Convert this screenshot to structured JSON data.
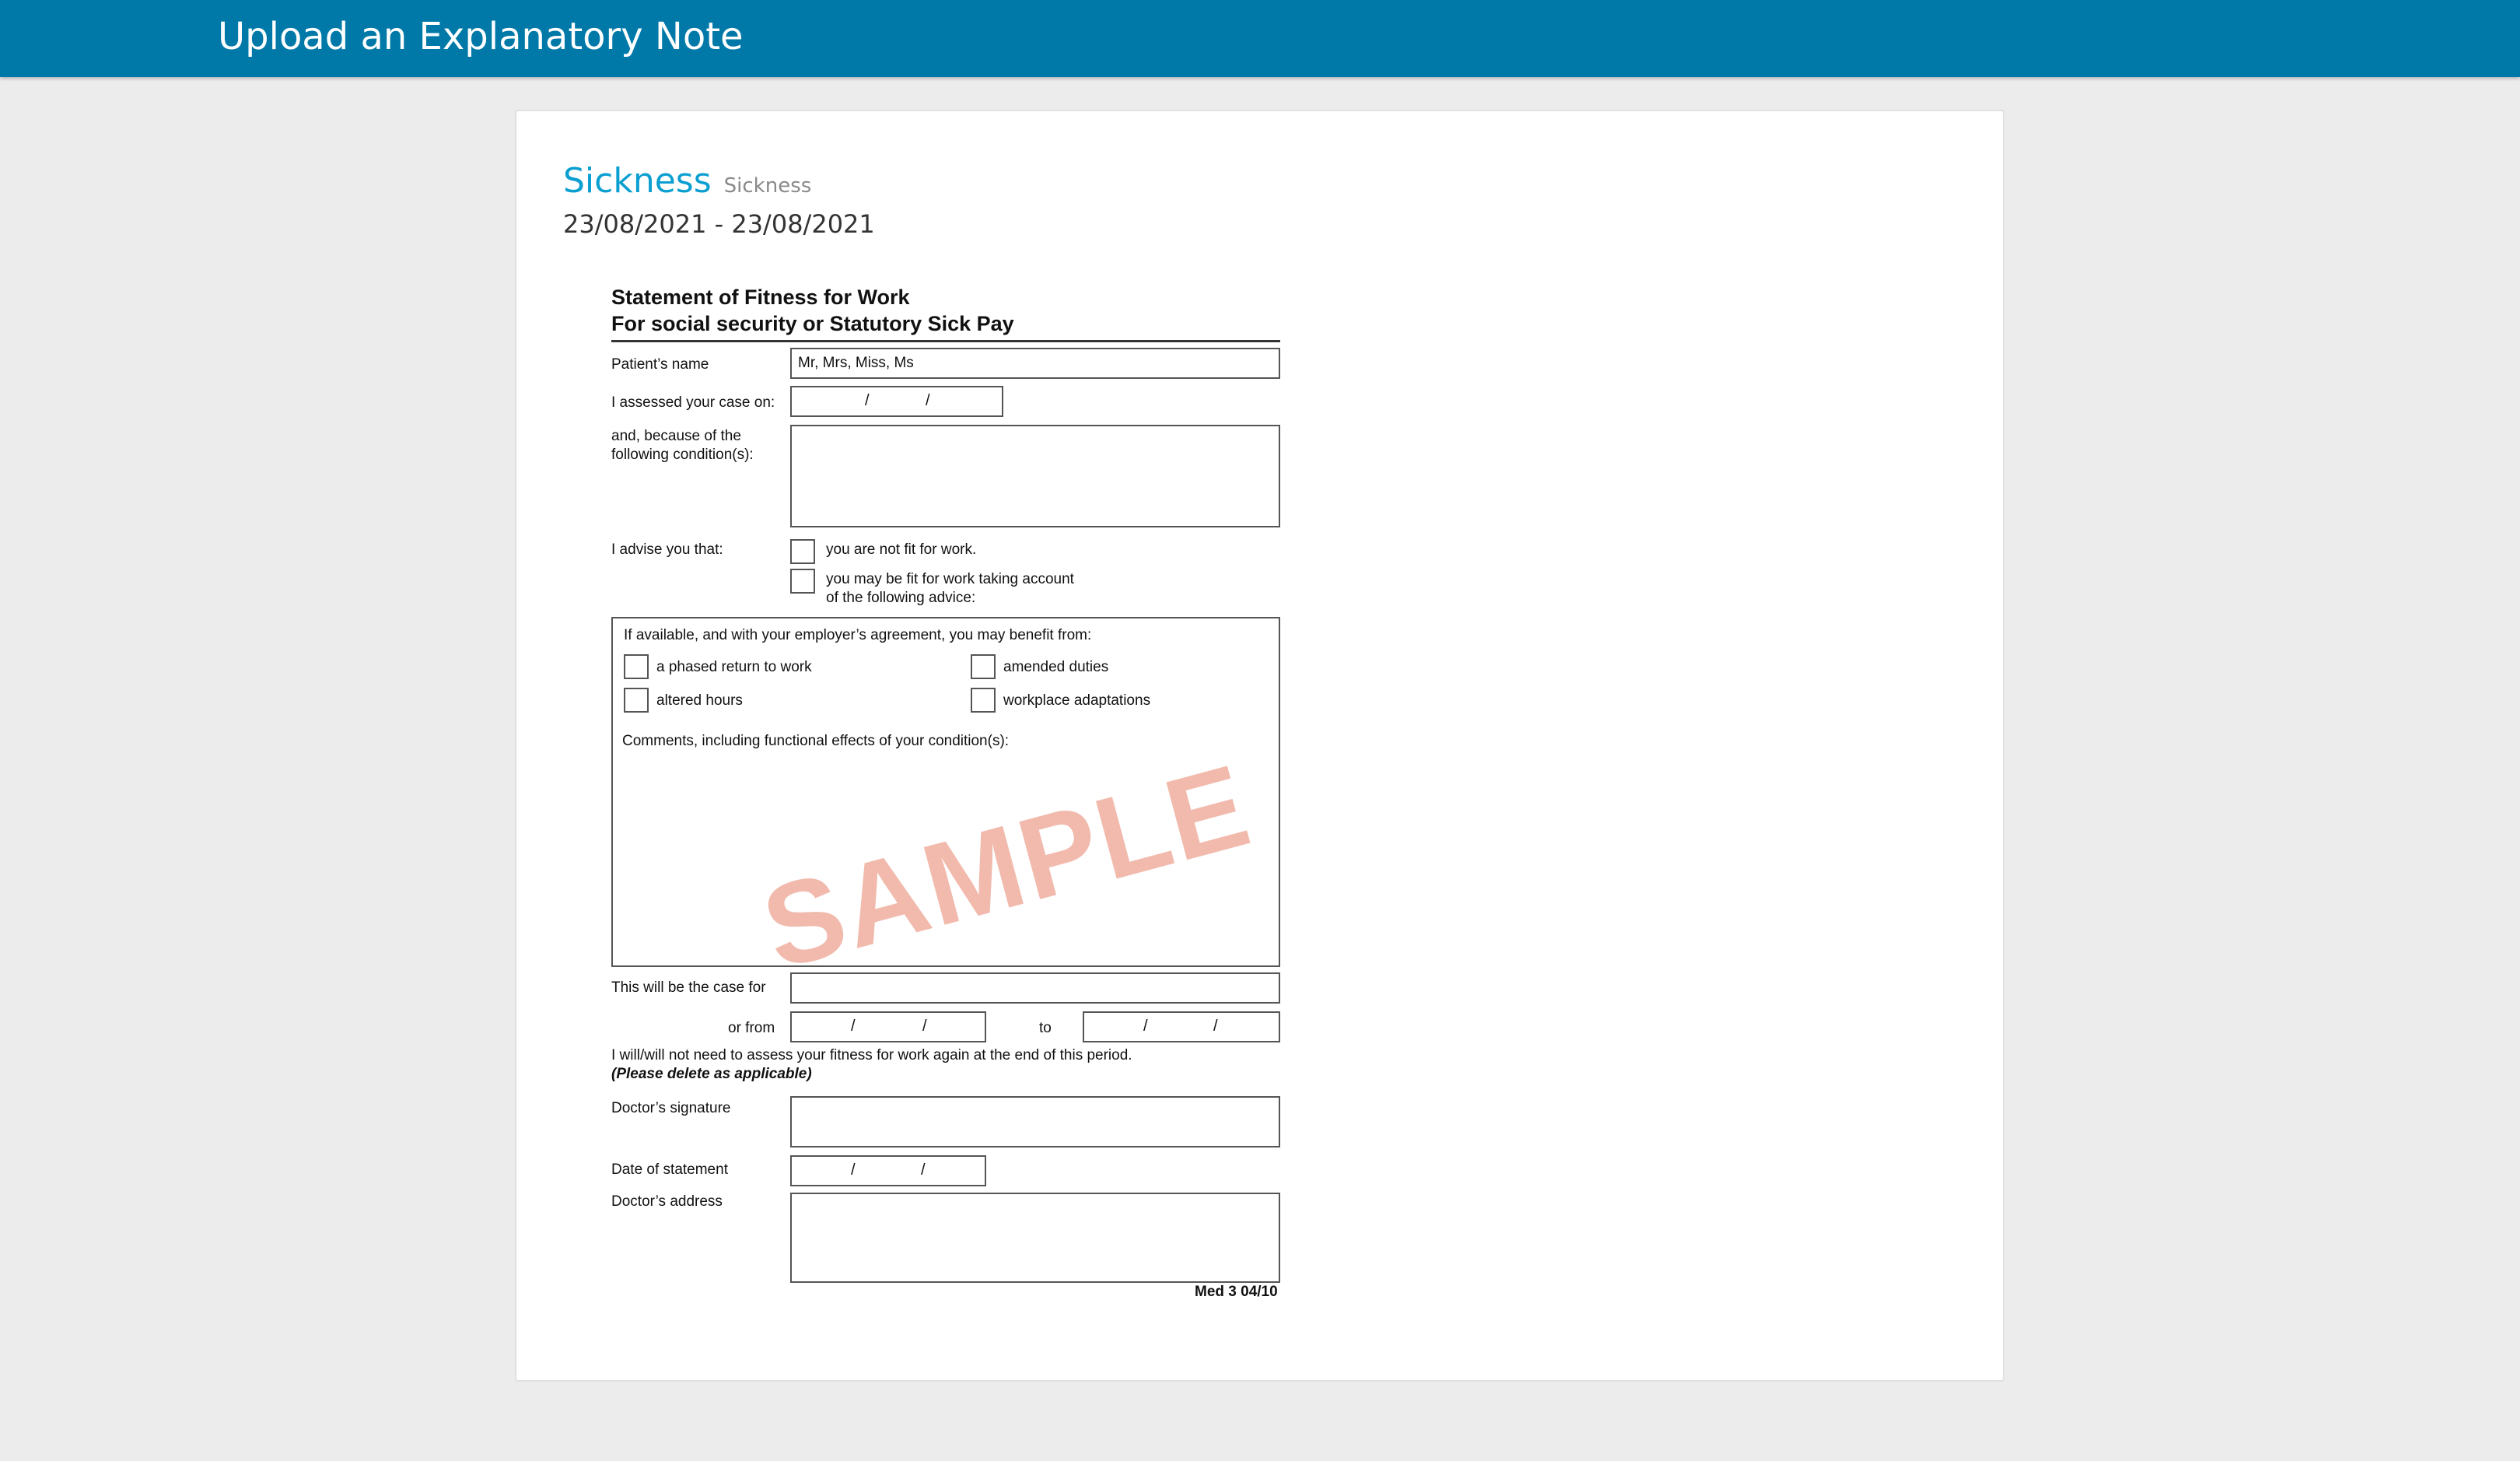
{
  "header": {
    "title": "Upload an Explanatory Note"
  },
  "note": {
    "title": "Sickness",
    "subtitle": "Sickness",
    "date_range": "23/08/2021 - 23/08/2021"
  },
  "form": {
    "title_line1": "Statement of Fitness for Work",
    "title_line2": "For social security or Statutory Sick Pay",
    "patient_name_label": "Patient’s name",
    "patient_name_value": "Mr, Mrs, Miss, Ms",
    "assessed_label": "I assessed your case on:",
    "date_slash": "/",
    "conditions_label_1": "and, because of the",
    "conditions_label_2": "following condition(s):",
    "advise_label": "I advise you that:",
    "option_not_fit": "you are not fit for work.",
    "option_may_be_fit_1": "you may be fit for work taking account",
    "option_may_be_fit_2": "of the following advice:",
    "benefit_intro": "If available, and with your employer’s agreement, you may benefit from:",
    "benefit_phased": "a phased return to work",
    "benefit_amended": "amended duties",
    "benefit_altered": "altered hours",
    "benefit_adaptations": "workplace adaptations",
    "comments_label": "Comments, including functional effects of your condition(s):",
    "watermark": "SAMPLE",
    "case_for_label": "This will be the case for",
    "or_from_label": "or from",
    "to_label": "to",
    "assess_again": "I will/will not need to assess your fitness for work again at the end of this period.",
    "please_delete": "(Please delete as applicable)",
    "signature_label": "Doctor’s signature",
    "date_statement_label": "Date of statement",
    "address_label": "Doctor’s address",
    "form_code": "Med 3 04/10"
  }
}
